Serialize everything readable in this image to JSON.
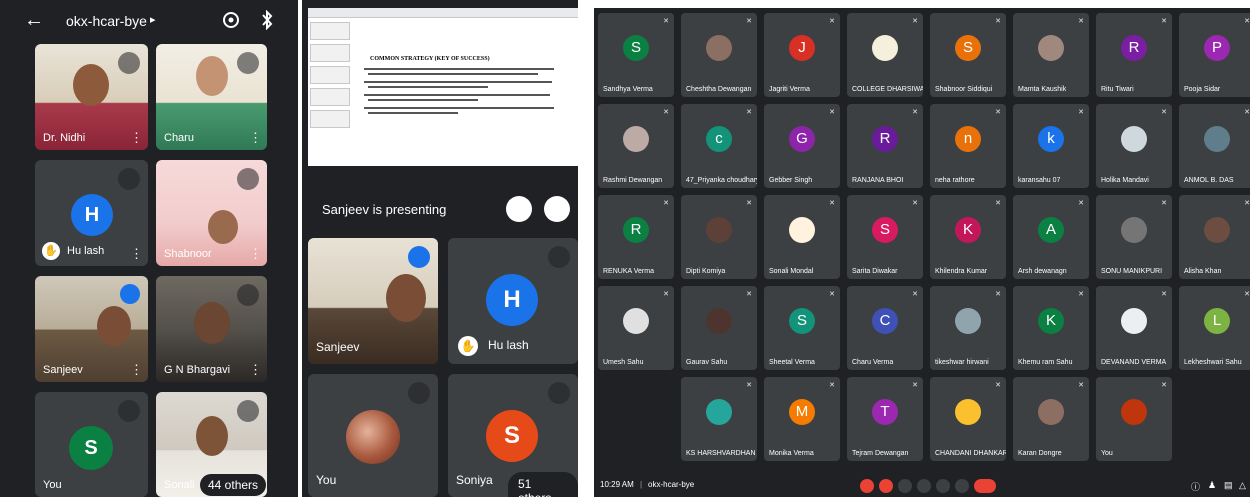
{
  "mobile": {
    "meeting_code": "okx-hcar-bye",
    "tiles": [
      {
        "name": "Dr. Nidhi"
      },
      {
        "name": "Charu"
      },
      {
        "name": "Hu lash",
        "initial": "H"
      },
      {
        "name": "Shabnoor"
      },
      {
        "name": "Sanjeev"
      },
      {
        "name": "G N Bhargavi"
      },
      {
        "name": "You",
        "initial": "S"
      },
      {
        "name": "Sonali"
      }
    ],
    "others": "44 others"
  },
  "presentation": {
    "banner": "Sanjeev is presenting",
    "slide_title": "COMMON STRATEGY (KEY OF SUCCESS)",
    "tiles": [
      {
        "name": "Sanjeev"
      },
      {
        "name": "Hu lash",
        "initial": "H"
      },
      {
        "name": "You"
      },
      {
        "name": "Soniya",
        "initial": "S"
      }
    ],
    "others": "51 others"
  },
  "desktop": {
    "time": "10:29 AM",
    "separator": "|",
    "meeting_code": "okx-hcar-bye",
    "participants": [
      {
        "name": "Sandhya Verma",
        "initial": "S",
        "color": "#0b8043"
      },
      {
        "name": "Cheshtha Dewangan",
        "initial": "",
        "color": "#8d6e63"
      },
      {
        "name": "Jagriti Verma",
        "initial": "J",
        "color": "#d93025"
      },
      {
        "name": "COLLEGE DHARSIWA",
        "initial": "",
        "color": "#f4f0dc"
      },
      {
        "name": "Shabnoor Siddiqui",
        "initial": "S",
        "color": "#e8710a"
      },
      {
        "name": "Mamta Kaushik",
        "initial": "",
        "color": "#a1887f"
      },
      {
        "name": "Ritu Tiwari",
        "initial": "R",
        "color": "#7b1fa2"
      },
      {
        "name": "Pooja Sidar",
        "initial": "P",
        "color": "#9c27b0"
      },
      {
        "name": "Rashmi Dewangan",
        "initial": "",
        "color": "#bcaaa4"
      },
      {
        "name": "47_Priyanka choudhary",
        "initial": "c",
        "color": "#12937a"
      },
      {
        "name": "Gebber Singh",
        "initial": "G",
        "color": "#8e24aa"
      },
      {
        "name": "RANJANA BHOI",
        "initial": "R",
        "color": "#6a1b9a"
      },
      {
        "name": "neha rathore",
        "initial": "n",
        "color": "#e8710a"
      },
      {
        "name": "karansahu 07",
        "initial": "k",
        "color": "#1a73e8"
      },
      {
        "name": "Holika Mandavi",
        "initial": "",
        "color": "#cfd8dc"
      },
      {
        "name": "ANMOL B. DAS",
        "initial": "",
        "color": "#607d8b"
      },
      {
        "name": "RENUKA Verma",
        "initial": "R",
        "color": "#0b8043"
      },
      {
        "name": "Dipti Komiya",
        "initial": "",
        "color": "#5d4037"
      },
      {
        "name": "Sonali Mondal",
        "initial": "",
        "color": "#fff3e0"
      },
      {
        "name": "Sarita Diwakar",
        "initial": "S",
        "color": "#d81b60"
      },
      {
        "name": "Khilendra Kumar",
        "initial": "K",
        "color": "#c2185b"
      },
      {
        "name": "Arsh dewanagn",
        "initial": "A",
        "color": "#0b8043"
      },
      {
        "name": "SONU MANIKPURI",
        "initial": "",
        "color": "#757575"
      },
      {
        "name": "Alisha Khan",
        "initial": "",
        "color": "#6d4c41"
      },
      {
        "name": "Umesh Sahu",
        "initial": "",
        "color": "#e0e0e0"
      },
      {
        "name": "Gaurav Sahu",
        "initial": "",
        "color": "#4e342e"
      },
      {
        "name": "Sheetal Verma",
        "initial": "S",
        "color": "#12937a"
      },
      {
        "name": "Charu Verma",
        "initial": "C",
        "color": "#3f51b5"
      },
      {
        "name": "tikeshwar hirwani",
        "initial": "",
        "color": "#90a4ae"
      },
      {
        "name": "Khemu ram Sahu",
        "initial": "K",
        "color": "#0b8043"
      },
      {
        "name": "DEVANAND VERMA",
        "initial": "",
        "color": "#eceff1"
      },
      {
        "name": "Lekheshwari Sahu",
        "initial": "L",
        "color": "#7cb342"
      },
      {
        "name": "KS HARSHVARDHAN SIN...",
        "initial": "",
        "color": "#26a69a"
      },
      {
        "name": "Monika Verma",
        "initial": "M",
        "color": "#f57c00"
      },
      {
        "name": "Tejram Dewangan",
        "initial": "T",
        "color": "#9c27b0"
      },
      {
        "name": "CHANDANI DHANKAR",
        "initial": "",
        "color": "#fbc02d"
      },
      {
        "name": "Karan Dongre",
        "initial": "",
        "color": "#8d6e63"
      },
      {
        "name": "You",
        "initial": "",
        "color": "#bf360c"
      }
    ]
  }
}
